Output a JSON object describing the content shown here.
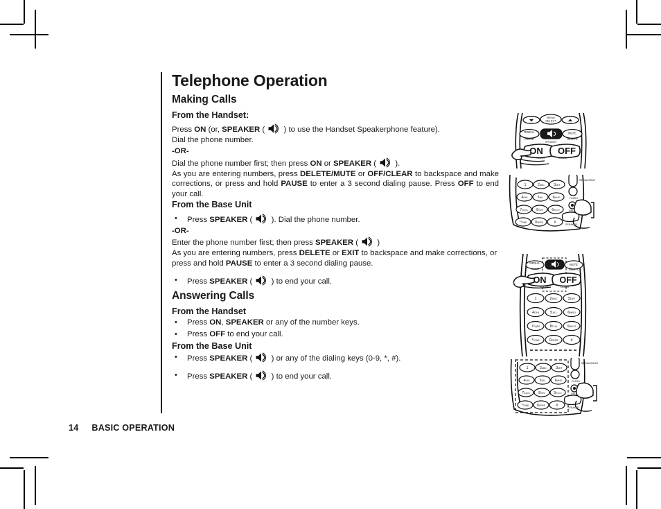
{
  "document": {
    "title": "Telephone Operation",
    "page_number": "14",
    "footer_section": "BASIC OPERATION"
  },
  "sections": [
    {
      "heading": "Making Calls",
      "subsections": [
        {
          "subheading": "From the Handset:",
          "lines": [
            "Press ON (or, SPEAKER ( ◀)) ) to use the Handset Speakerphone feature).",
            "Dial the phone number."
          ],
          "or_label": "-OR-",
          "after_or": [
            "Dial the phone number first; then press ON or SPEAKER ( ) ).",
            "As you are entering numbers, press DELETE/MUTE or OFF/CLEAR to backspace and make corrections, or press and hold PAUSE to enter a 3 second dialing pause. Press OFF to end your call."
          ]
        },
        {
          "subheading": "From the Base Unit",
          "bullet1": "Press SPEAKER ( ). Dial the phone number.",
          "or_label": "-OR-",
          "after_or": [
            "Enter the phone number first; then press SPEAKER ( )",
            "As you are entering numbers, press DELETE or EXIT to backspace and make corrections, or press and hold PAUSE to enter a 3 second dialing pause."
          ],
          "bullet2": "Press SPEAKER ( ) to end your call."
        }
      ]
    },
    {
      "heading": "Answering Calls",
      "subsections": [
        {
          "subheading": "From the Handset",
          "bullets": [
            "Press ON, SPEAKER or any of the number keys.",
            "Press OFF to end your call."
          ]
        },
        {
          "subheading": "From the Base Unit",
          "bullets": [
            "Press SPEAKER ( ) or any of the dialing keys (0-9, *, #).",
            "Press SPEAKER ( ) to end your call."
          ]
        }
      ]
    }
  ],
  "text": {
    "t_press": "Press ",
    "t_on": "ON",
    "t_or_paren": " (or, ",
    "t_speaker": "SPEAKER",
    "t_open": " ( ",
    "t_close": " ) ",
    "t_use_handset": " ) to use the Handset Speakerphone feature).",
    "t_dial_number": "Dial the phone number.",
    "t_or": "-OR-",
    "t_dial_first_a": "Dial the phone number first; then press ",
    "t_or_word": " or ",
    "t_close_period": " ).",
    "t_asyou_a": "As you are entering numbers, press ",
    "t_delete_mute": "DELETE/MUTE",
    "t_off_clear": "OFF/CLEAR",
    "t_asyou_b": " to backspace and make corrections, or press and hold ",
    "t_pause": "PAUSE",
    "t_asyou_c": " to enter a 3 second dialing pause. Press ",
    "t_off": "OFF",
    "t_asyou_d": " to end your call.",
    "t_bu_b1_a": "Press ",
    "t_bu_b1_b": " ). Dial the phone number.",
    "t_enter_first": "Enter the phone number first; then press ",
    "t_close_paren": " )",
    "t_asyou2_a": "As you are entering numbers, press ",
    "t_delete": "DELETE",
    "t_exit": "EXIT",
    "t_asyou2_b": " to backspace and make corrections, or press and hold ",
    "t_asyou2_c": " to enter a 3 second dialing pause.",
    "t_end_call": " ) to end your call.",
    "t_ans_h1_a": "Press ",
    "t_ans_h1_b": ", ",
    "t_ans_h1_c": " or any of the number keys.",
    "t_ans_h2_b": " to end your call.",
    "t_ans_b1_b": " ) or any of the dialing keys (0-9, *, #).",
    "bullet": "•"
  },
  "icons": {
    "speaker": "speaker-icon"
  },
  "illustrations": [
    {
      "name": "handset-top-keys",
      "caption": "",
      "keys": [
        "REDIAL/PAUSE",
        "MENU/SELECT",
        "MUTE/DELETE",
        "ON/FLASH",
        "OFF/CLEAR",
        "SPEAKER"
      ]
    },
    {
      "name": "base-unit-keypad-speaker",
      "caption": "",
      "keys": [
        "1",
        "2 ABC",
        "3 DEF",
        "4 GHI",
        "5 JKL",
        "6 MNO",
        "7 PQRS",
        "8 TUV",
        "9 WXYZ",
        "* TONE",
        "0 OPER",
        "#",
        "REDIAL/PAUSE",
        "FLASH",
        "DEL",
        "SPEAKER"
      ]
    },
    {
      "name": "handset-full-keypad",
      "caption": "",
      "keys": [
        "REDIAL",
        "MUTE",
        "ON/FLASH",
        "OFF/CLEAR",
        "1",
        "2 ABC",
        "3 DEF",
        "4 GHI",
        "5 JKL",
        "6 MNO",
        "7 PQRS",
        "8 TUV",
        "9 WXYZ",
        "* TONE",
        "0 OPER",
        "#"
      ]
    },
    {
      "name": "base-unit-keypad-dialing-keys",
      "caption": "",
      "keys": [
        "1",
        "2 ABC",
        "3 DEF",
        "4 GHI",
        "5 JKL",
        "6 MNO",
        "7 PQRS",
        "8 TUV",
        "9 WXYZ",
        "* TONE",
        "0 OPER",
        "#",
        "REDIAL/PAUSE",
        "FLASH",
        "DEL",
        "SPEAKER"
      ]
    }
  ],
  "colors": {
    "text": "#1a1a1a",
    "background": "#ffffff",
    "rule": "#1a1a1a"
  }
}
